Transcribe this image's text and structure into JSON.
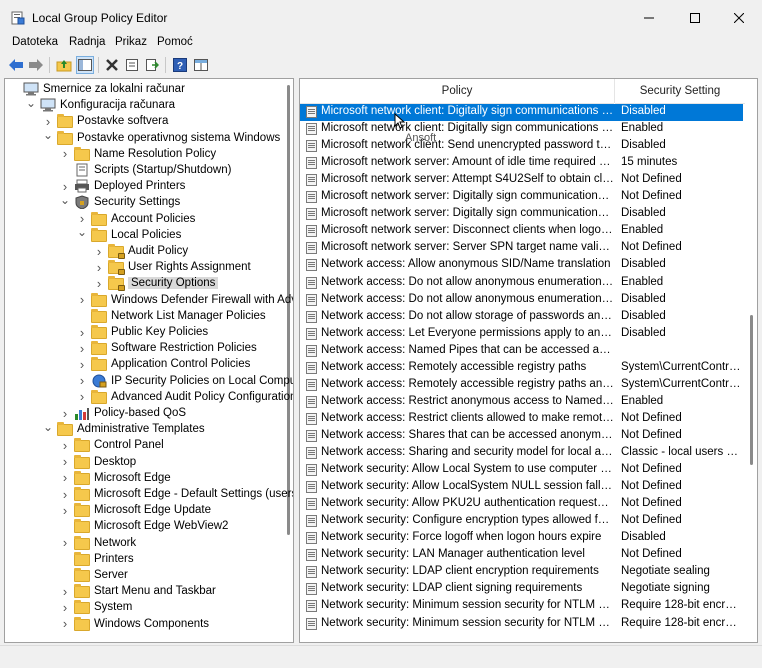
{
  "window": {
    "title": "Local Group Policy Editor",
    "minimize": "—",
    "maximize": "☐",
    "close": "✕"
  },
  "menu": [
    "Datoteka",
    "Radnja",
    "Prikaz",
    "Pomoć"
  ],
  "tree": [
    {
      "label": "Smernice za lokalni računar",
      "depth": 0,
      "chev": "",
      "icon": "computer"
    },
    {
      "label": "Konfiguracija računara",
      "depth": 1,
      "chev": "open",
      "icon": "computer"
    },
    {
      "label": "Postavke softvera",
      "depth": 2,
      "chev": "closed",
      "icon": "folder"
    },
    {
      "label": "Postavke operativnog sistema Windows",
      "depth": 2,
      "chev": "open",
      "icon": "folder"
    },
    {
      "label": "Name Resolution Policy",
      "depth": 3,
      "chev": "closed",
      "icon": "folder"
    },
    {
      "label": "Scripts (Startup/Shutdown)",
      "depth": 3,
      "chev": "",
      "icon": "script"
    },
    {
      "label": "Deployed Printers",
      "depth": 3,
      "chev": "closed",
      "icon": "printer"
    },
    {
      "label": "Security Settings",
      "depth": 3,
      "chev": "open",
      "icon": "shield"
    },
    {
      "label": "Account Policies",
      "depth": 4,
      "chev": "closed",
      "icon": "folder"
    },
    {
      "label": "Local Policies",
      "depth": 4,
      "chev": "open",
      "icon": "folder"
    },
    {
      "label": "Audit Policy",
      "depth": 5,
      "chev": "closed",
      "icon": "folder-lock"
    },
    {
      "label": "User Rights Assignment",
      "depth": 5,
      "chev": "closed",
      "icon": "folder-lock"
    },
    {
      "label": "Security Options",
      "depth": 5,
      "chev": "closed",
      "icon": "folder-lock",
      "selected": true
    },
    {
      "label": "Windows Defender Firewall with Advan",
      "depth": 4,
      "chev": "closed",
      "icon": "folder"
    },
    {
      "label": "Network List Manager Policies",
      "depth": 4,
      "chev": "",
      "icon": "folder"
    },
    {
      "label": "Public Key Policies",
      "depth": 4,
      "chev": "closed",
      "icon": "folder"
    },
    {
      "label": "Software Restriction Policies",
      "depth": 4,
      "chev": "closed",
      "icon": "folder"
    },
    {
      "label": "Application Control Policies",
      "depth": 4,
      "chev": "closed",
      "icon": "folder"
    },
    {
      "label": "IP Security Policies on Local Computer",
      "depth": 4,
      "chev": "closed",
      "icon": "ipsec"
    },
    {
      "label": "Advanced Audit Policy Configuration",
      "depth": 4,
      "chev": "closed",
      "icon": "folder"
    },
    {
      "label": "Policy-based QoS",
      "depth": 3,
      "chev": "closed",
      "icon": "chart"
    },
    {
      "label": "Administrative Templates",
      "depth": 2,
      "chev": "open",
      "icon": "folder"
    },
    {
      "label": "Control Panel",
      "depth": 3,
      "chev": "closed",
      "icon": "folder"
    },
    {
      "label": "Desktop",
      "depth": 3,
      "chev": "closed",
      "icon": "folder"
    },
    {
      "label": "Microsoft Edge",
      "depth": 3,
      "chev": "closed",
      "icon": "folder"
    },
    {
      "label": "Microsoft Edge - Default Settings (users ca",
      "depth": 3,
      "chev": "closed",
      "icon": "folder"
    },
    {
      "label": "Microsoft Edge Update",
      "depth": 3,
      "chev": "closed",
      "icon": "folder"
    },
    {
      "label": "Microsoft Edge WebView2",
      "depth": 3,
      "chev": "",
      "icon": "folder"
    },
    {
      "label": "Network",
      "depth": 3,
      "chev": "closed",
      "icon": "folder"
    },
    {
      "label": "Printers",
      "depth": 3,
      "chev": "",
      "icon": "folder"
    },
    {
      "label": "Server",
      "depth": 3,
      "chev": "",
      "icon": "folder"
    },
    {
      "label": "Start Menu and Taskbar",
      "depth": 3,
      "chev": "closed",
      "icon": "folder"
    },
    {
      "label": "System",
      "depth": 3,
      "chev": "closed",
      "icon": "folder"
    },
    {
      "label": "Windows Components",
      "depth": 3,
      "chev": "closed",
      "icon": "folder"
    }
  ],
  "list": {
    "col_policy": "Policy",
    "col_setting": "Security Setting",
    "tooltip": "Ansoft",
    "rows": [
      {
        "policy": "Microsoft network client: Digitally sign communications (al...",
        "setting": "Disabled",
        "selected": true
      },
      {
        "policy": "Microsoft network client: Digitally sign communications (if ...",
        "setting": "Enabled"
      },
      {
        "policy": "Microsoft network client: Send unencrypted password to thi...",
        "setting": "Disabled"
      },
      {
        "policy": "Microsoft network server: Amount of idle time required bef...",
        "setting": "15 minutes"
      },
      {
        "policy": "Microsoft network server: Attempt S4U2Self to obtain claim ...",
        "setting": "Not Defined"
      },
      {
        "policy": "Microsoft network server: Digitally sign communications (al...",
        "setting": "Not Defined"
      },
      {
        "policy": "Microsoft network server: Digitally sign communications (if ...",
        "setting": "Disabled"
      },
      {
        "policy": "Microsoft network server: Disconnect clients when logon ho...",
        "setting": "Enabled"
      },
      {
        "policy": "Microsoft network server: Server SPN target name validation...",
        "setting": "Not Defined"
      },
      {
        "policy": "Network access: Allow anonymous SID/Name translation",
        "setting": "Disabled"
      },
      {
        "policy": "Network access: Do not allow anonymous enumeration of S...",
        "setting": "Enabled"
      },
      {
        "policy": "Network access: Do not allow anonymous enumeration of S...",
        "setting": "Disabled"
      },
      {
        "policy": "Network access: Do not allow storage of passwords and cre...",
        "setting": "Disabled"
      },
      {
        "policy": "Network access: Let Everyone permissions apply to anonym...",
        "setting": "Disabled"
      },
      {
        "policy": "Network access: Named Pipes that can be accessed anonym...",
        "setting": ""
      },
      {
        "policy": "Network access: Remotely accessible registry paths",
        "setting": "System\\CurrentControlS..."
      },
      {
        "policy": "Network access: Remotely accessible registry paths and sub...",
        "setting": "System\\CurrentControlS..."
      },
      {
        "policy": "Network access: Restrict anonymous access to Named Pipes...",
        "setting": "Enabled"
      },
      {
        "policy": "Network access: Restrict clients allowed to make remote call...",
        "setting": "Not Defined"
      },
      {
        "policy": "Network access: Shares that can be accessed anonymously",
        "setting": "Not Defined"
      },
      {
        "policy": "Network access: Sharing and security model for local accou...",
        "setting": "Classic - local users auth..."
      },
      {
        "policy": "Network security: Allow Local System to use computer ident...",
        "setting": "Not Defined"
      },
      {
        "policy": "Network security: Allow LocalSystem NULL session fallback",
        "setting": "Not Defined"
      },
      {
        "policy": "Network security: Allow PKU2U authentication requests to t...",
        "setting": "Not Defined"
      },
      {
        "policy": "Network security: Configure encryption types allowed for Ke...",
        "setting": "Not Defined"
      },
      {
        "policy": "Network security: Force logoff when logon hours expire",
        "setting": "Disabled"
      },
      {
        "policy": "Network security: LAN Manager authentication level",
        "setting": "Not Defined"
      },
      {
        "policy": "Network security: LDAP client encryption requirements",
        "setting": "Negotiate sealing"
      },
      {
        "policy": "Network security: LDAP client signing requirements",
        "setting": "Negotiate signing"
      },
      {
        "policy": "Network security: Minimum session security for NTLM SSP ...",
        "setting": "Require 128-bit encrypti..."
      },
      {
        "policy": "Network security: Minimum session security for NTLM SSP ...",
        "setting": "Require 128-bit encrypti..."
      }
    ]
  },
  "colors": {
    "selection": "#0078d7",
    "tree_selection": "#d9d9d9"
  }
}
